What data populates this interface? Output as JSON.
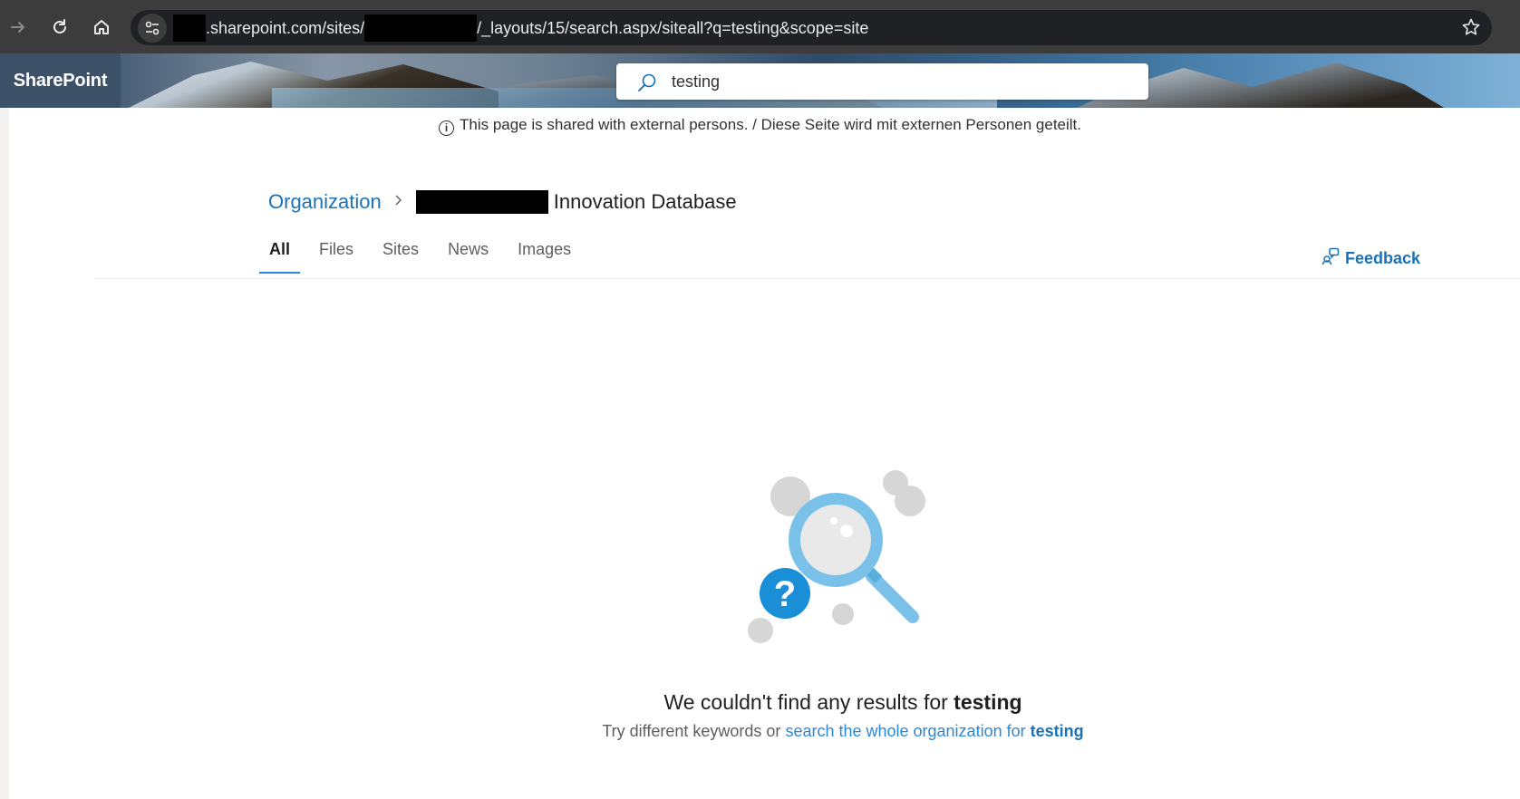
{
  "browser": {
    "url_part1": ".sharepoint.com/sites/",
    "url_part2": "/_layouts/15/search.aspx/siteall?q=testing&scope=site",
    "icons": [
      "forward-arrow-icon",
      "reload-icon",
      "home-icon",
      "site-settings-icon",
      "bookmark-star-icon"
    ]
  },
  "suite": {
    "brand": "SharePoint",
    "search_value": "testing"
  },
  "notice": {
    "text": "This page is shared with external persons. / Diese Seite wird mit externen Personen geteilt."
  },
  "breadcrumb": {
    "root": "Organization",
    "current": "Innovation Database"
  },
  "tabs": [
    "All",
    "Files",
    "Sites",
    "News",
    "Images"
  ],
  "feedback": {
    "label": "Feedback"
  },
  "empty_state": {
    "title_prefix": "We couldn't find any results for",
    "query": "testing",
    "sub_prefix": "Try different keywords or",
    "sub_link": "search the whole organization for",
    "sub_query": "testing"
  },
  "colors": {
    "link": "#2b88d8",
    "brand_bg": "#3d5268",
    "question_badge": "#1a8fd8",
    "magnifier": "#7ac1ea"
  }
}
